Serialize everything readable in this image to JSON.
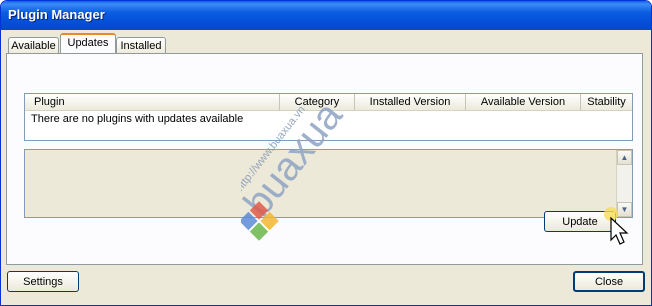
{
  "window": {
    "title": "Plugin Manager"
  },
  "tabs": [
    {
      "label": "Available",
      "active": false
    },
    {
      "label": "Updates",
      "active": true
    },
    {
      "label": "Installed",
      "active": false
    }
  ],
  "table": {
    "columns": [
      "Plugin",
      "Category",
      "Installed Version",
      "Available Version",
      "Stability"
    ],
    "empty_message": "There are no plugins with updates available"
  },
  "buttons": {
    "update": "Update",
    "settings": "Settings",
    "close": "Close"
  },
  "watermark": {
    "url_text": "http://www.buaxua.vn",
    "brand_text": "buaxua"
  },
  "colors": {
    "title_bar": "#0a5fe6",
    "highlight_circle": "#c9201e",
    "dialog_bg": "#ece9d8"
  }
}
